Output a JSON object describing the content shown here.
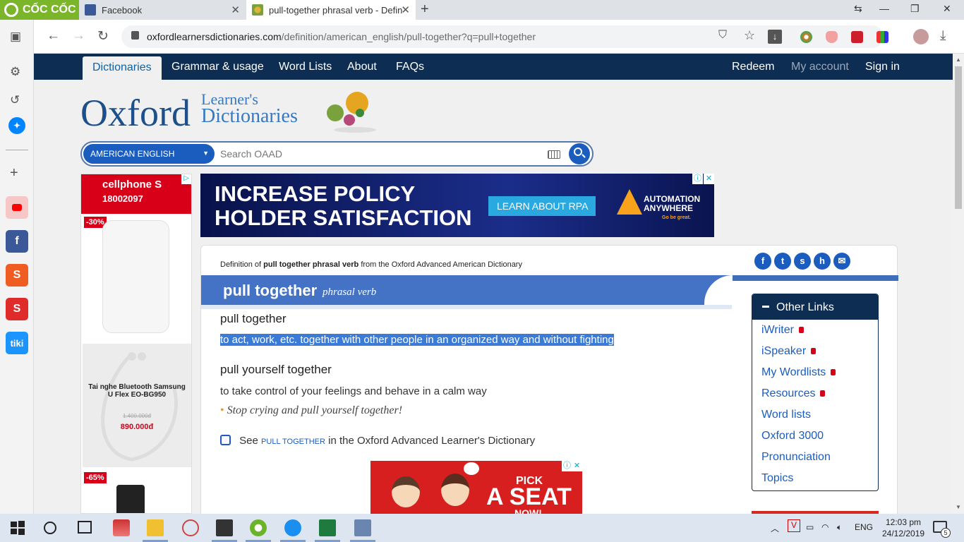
{
  "browser": {
    "brand": "CỐC CỐC",
    "tabs": [
      {
        "title": "Facebook"
      },
      {
        "title": "pull-together phrasal verb - Defini"
      }
    ],
    "url_host": "oxfordlearnersdictionaries.com",
    "url_path": "/definition/american_english/pull-together?q=pull+together"
  },
  "site": {
    "nav_left": [
      "Dictionaries",
      "Grammar & usage",
      "Word Lists",
      "About",
      "FAQs"
    ],
    "nav_right": [
      "Redeem",
      "My account",
      "Sign in"
    ],
    "logo_main": "Oxford",
    "logo_line1": "Learner's",
    "logo_line2": "Dictionaries",
    "dict_select": "AMERICAN ENGLISH",
    "search_placeholder": "Search OAAD"
  },
  "left_ad": {
    "brand": "cellphone S",
    "phone": "18002097",
    "discount_top": "-30%",
    "product_name": "Tai nghe Bluetooth Samsung U Flex EO-BG950",
    "old_price": "1.400.000đ",
    "price": "890.000đ",
    "discount_bottom": "-65%"
  },
  "banner_ad": {
    "line1": "INCREASE POLICY",
    "line2": "HOLDER SATISFACTION",
    "cta": "LEARN ABOUT RPA",
    "logo_top": "AUTOMATION",
    "logo_bottom": "ANYWHERE",
    "tagline": "Go be great."
  },
  "entry": {
    "definition_prefix": "Definition of",
    "definition_headword": "pull together phrasal verb",
    "definition_suffix": "from the Oxford Advanced American Dictionary",
    "headword": "pull together",
    "pos": "phrasal verb",
    "senses": [
      {
        "title": "pull together",
        "definition": "to act, work, etc. together with other people in an organized way and without fighting"
      },
      {
        "title": "pull yourself together",
        "definition": "to take control of your feelings and behave in a calm way",
        "example": "Stop crying and pull yourself together!"
      }
    ],
    "see_prefix": "See",
    "see_link": "PULL TOGETHER",
    "see_suffix": "in the Oxford Advanced Learner's Dictionary"
  },
  "seat_ad": {
    "pick": "PICK",
    "seat": "A SEAT",
    "now": "NOW!"
  },
  "other_links": {
    "title": "Other Links",
    "items": [
      "iWriter",
      "iSpeaker",
      "My Wordlists",
      "Resources",
      "Word lists",
      "Oxford 3000",
      "Pronunciation",
      "Topics"
    ]
  },
  "taskbar": {
    "language": "ENG",
    "time": "12:03 pm",
    "date": "24/12/2019",
    "notifications": "5"
  },
  "colors": {
    "navbar": "#0d2d52",
    "accent": "#1a5dbf",
    "headword_bar": "#4472c4",
    "highlight": "#3b7bd8"
  }
}
